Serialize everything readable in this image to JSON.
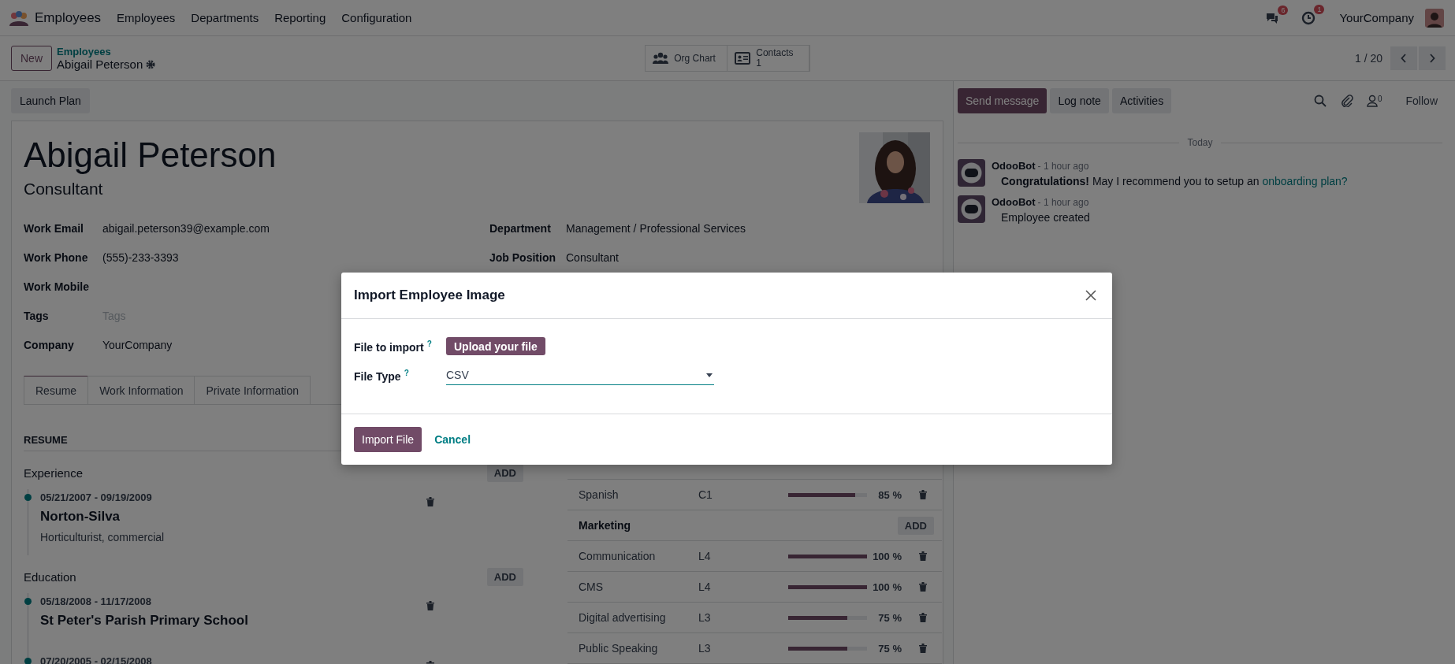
{
  "navbar": {
    "app_title": "Employees",
    "menu": [
      "Employees",
      "Departments",
      "Reporting",
      "Configuration"
    ],
    "messages_badge": "6",
    "activities_badge": "1",
    "company": "YourCompany"
  },
  "control_panel": {
    "new_button": "New",
    "breadcrumb_parent": "Employees",
    "breadcrumb_current": "Abigail Peterson",
    "smart_buttons": [
      {
        "kind": "org",
        "label": "Org Chart"
      },
      {
        "kind": "contacts",
        "label": "Contacts",
        "value": "1"
      }
    ],
    "pager": "1 / 20"
  },
  "form": {
    "action_button": "Launch Plan",
    "name": "Abigail Peterson",
    "job_title": "Consultant",
    "fields_left": [
      {
        "label": "Work Email",
        "value": "abigail.peterson39@example.com"
      },
      {
        "label": "Work Phone",
        "value": "(555)-233-3393"
      },
      {
        "label": "Work Mobile"
      },
      {
        "label": "Tags",
        "placeholder": "Tags"
      },
      {
        "label": "Company",
        "value": "YourCompany"
      }
    ],
    "fields_right": [
      {
        "label": "Department",
        "value": "Management / Professional Services"
      },
      {
        "label": "Job Position",
        "value": "Consultant"
      }
    ],
    "tabs": [
      {
        "label": "Resume",
        "selected": true
      },
      {
        "label": "Work Information",
        "selected": false
      },
      {
        "label": "Private Information",
        "selected": false
      }
    ],
    "resume": {
      "title": "RESUME",
      "sections": [
        {
          "title": "Experience",
          "add": "ADD",
          "entries": [
            {
              "date": "05/21/2007 - 09/19/2009",
              "title": "Norton-Silva",
              "description": "Horticulturist, commercial"
            }
          ]
        },
        {
          "title": "Education",
          "add": "ADD",
          "entries": [
            {
              "date": "05/18/2008 - 11/17/2008",
              "title": "St Peter's Parish Primary School"
            },
            {
              "date": "07/20/2005 - 02/15/2008"
            }
          ]
        }
      ]
    },
    "skills": [
      {
        "kind": "skill",
        "name": "Spanish",
        "level_text": "C1",
        "level": 0.85,
        "percent": "85 %"
      },
      {
        "kind": "header",
        "name": "Marketing",
        "add": "ADD"
      },
      {
        "kind": "skill",
        "name": "Communication",
        "level_text": "L4",
        "level": 1,
        "percent": "100 %"
      },
      {
        "kind": "skill",
        "name": "CMS",
        "level_text": "L4",
        "level": 1,
        "percent": "100 %"
      },
      {
        "kind": "skill",
        "name": "Digital advertising",
        "level_text": "L3",
        "level": 0.75,
        "percent": "75 %"
      },
      {
        "kind": "skill",
        "name": "Public Speaking",
        "level_text": "L3",
        "level": 0.75,
        "percent": "75 %"
      }
    ]
  },
  "chatter": {
    "buttons": [
      {
        "label": "Send message",
        "selected": true
      },
      {
        "label": "Log note",
        "selected": false
      },
      {
        "label": "Activities",
        "selected": false
      }
    ],
    "followers_count": "0",
    "follow": "Follow",
    "date_separator": "Today",
    "messages": [
      {
        "author": "OdooBot",
        "time": "- 1 hour ago",
        "body": "**Congratulations!** May I recommend you to setup an",
        "link": "onboarding plan?"
      },
      {
        "author": "OdooBot",
        "time": "- 1 hour ago",
        "body": "Employee created"
      }
    ]
  },
  "dialog": {
    "title": "Import Employee Image",
    "fields": [
      {
        "kind": "upload",
        "label": "File to import",
        "help": "?",
        "button": "Upload your file"
      },
      {
        "kind": "select",
        "label": "File Type",
        "help": "?",
        "value": "CSV"
      }
    ],
    "primary_button": "Import File",
    "cancel_button": "Cancel"
  }
}
